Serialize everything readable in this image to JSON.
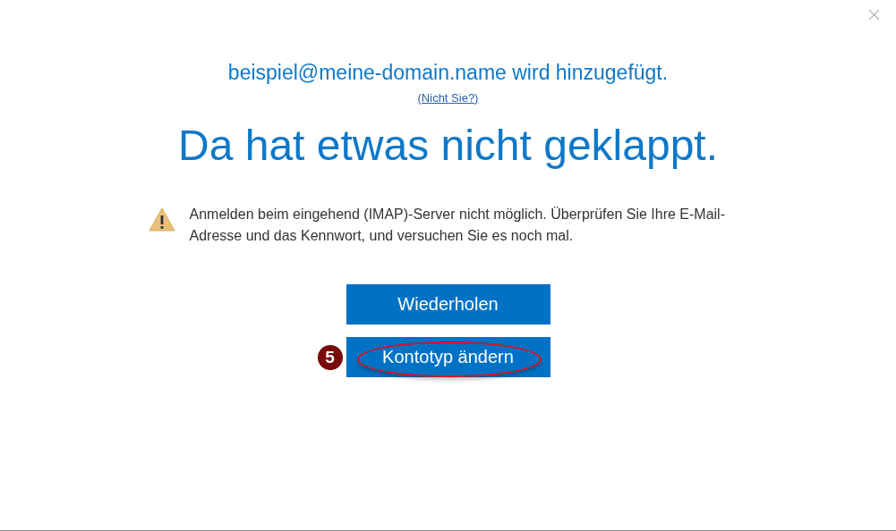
{
  "account": {
    "adding_text": "beispiel@meine-domain.name wird hinzugefügt.",
    "not_you_link": "(Nicht Sie?)"
  },
  "headline": "Da hat etwas nicht geklappt.",
  "message": {
    "kind": "warning",
    "text": "Anmelden beim eingehend (IMAP)-Server nicht möglich. Überprüfen Sie Ihre E-Mail-Adresse und das Kennwort, und versuchen Sie es noch mal."
  },
  "buttons": [
    {
      "label": "Wiederholen",
      "highlighted": false
    },
    {
      "label": "Kontotyp ändern",
      "highlighted": true,
      "step_badge": "5"
    }
  ]
}
